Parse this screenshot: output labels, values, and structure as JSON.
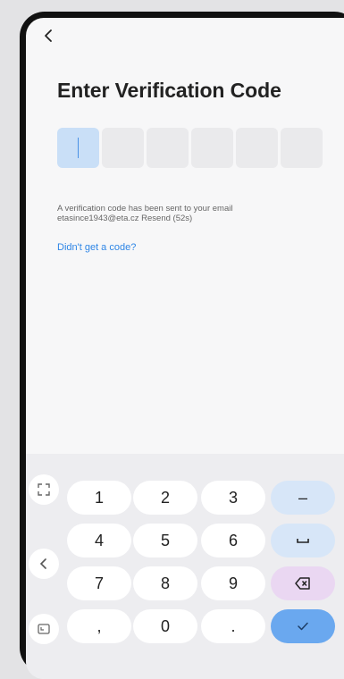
{
  "nav": {
    "back_icon": "chevron-left-icon"
  },
  "page": {
    "title": "Enter Verification Code"
  },
  "code": {
    "length": 6,
    "active_index": 0,
    "digits": [
      "",
      "",
      "",
      "",
      "",
      ""
    ]
  },
  "message": {
    "line1": "A verification code has been sent to your email",
    "email": "etasince1943@eta.cz",
    "resend": "Resend (52s)"
  },
  "help_link": "Didn't get a code?",
  "keyboard": {
    "keys": {
      "k1": "1",
      "k2": "2",
      "k3": "3",
      "k4": "4",
      "k5": "5",
      "k6": "6",
      "k7": "7",
      "k8": "8",
      "k9": "9",
      "comma": ",",
      "k0": "0",
      "dot": ".",
      "minus": "–",
      "space": "␣"
    },
    "side_icons": [
      "expand-icon",
      "chevron-left-icon",
      "keyboard-resize-icon"
    ],
    "action_icons": [
      "backspace-icon",
      "checkmark-icon"
    ]
  },
  "colors": {
    "accent": "#2f86e6",
    "active_box": "#c9dff7",
    "fn_key": "#d7e6f8",
    "delete_key": "#ead7f2",
    "confirm_key": "#6aa8ef"
  }
}
